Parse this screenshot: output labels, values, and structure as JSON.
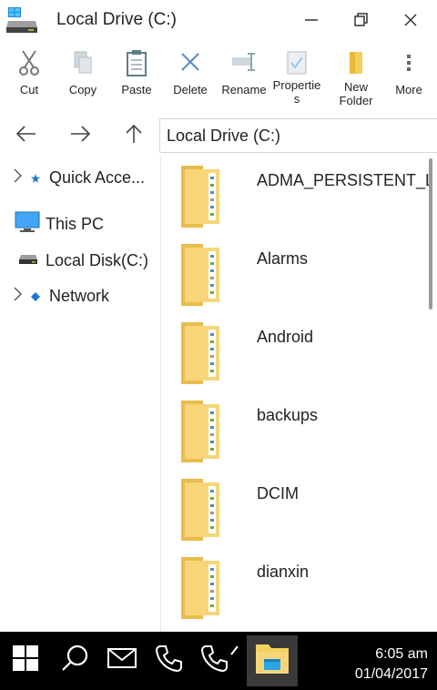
{
  "window": {
    "title": "Local Drive (C:)",
    "accent": "#1e88e5"
  },
  "ribbon": {
    "cut": "Cut",
    "copy": "Copy",
    "paste": "Paste",
    "delete": "Delete",
    "rename": "Rename",
    "properties_line1": "Propertie",
    "properties_line2": "s",
    "new_folder_line1": "New",
    "new_folder_line2": "Folder",
    "more": "More"
  },
  "address": {
    "path": "Local Drive (C:)"
  },
  "sidebar": {
    "items": [
      {
        "label": "Quick Acce...",
        "icon": "star-icon"
      },
      {
        "label": "This PC",
        "icon": "monitor-icon"
      },
      {
        "label": "Local Disk(C:)",
        "icon": "drive-icon"
      },
      {
        "label": "Network",
        "icon": "network-icon"
      }
    ]
  },
  "files": [
    {
      "name": "ADMA_PERSISTENT_L"
    },
    {
      "name": "Alarms"
    },
    {
      "name": "Android"
    },
    {
      "name": "backups"
    },
    {
      "name": "DCIM"
    },
    {
      "name": "dianxin"
    }
  ],
  "taskbar": {
    "time": "6:05 am",
    "date": "01/04/2017"
  }
}
